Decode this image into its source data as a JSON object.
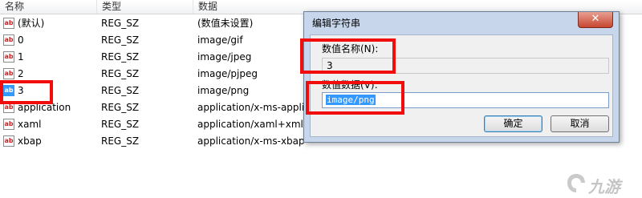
{
  "list": {
    "columns": [
      "名称",
      "类型",
      "数据"
    ],
    "rows": [
      {
        "name": "(默认)",
        "type": "REG_SZ",
        "data": "(数值未设置)"
      },
      {
        "name": "0",
        "type": "REG_SZ",
        "data": "image/gif"
      },
      {
        "name": "1",
        "type": "REG_SZ",
        "data": "image/jpeg"
      },
      {
        "name": "2",
        "type": "REG_SZ",
        "data": "image/pjpeg"
      },
      {
        "name": "3",
        "type": "REG_SZ",
        "data": "image/png"
      },
      {
        "name": "application",
        "type": "REG_SZ",
        "data": "application/x-ms-applic"
      },
      {
        "name": "xaml",
        "type": "REG_SZ",
        "data": "application/xaml+xml"
      },
      {
        "name": "xbap",
        "type": "REG_SZ",
        "data": "application/x-ms-xbap"
      }
    ],
    "icon_glyph": "ab",
    "selected_row": "3"
  },
  "dialog": {
    "title": "编辑字符串",
    "close_glyph": "✕",
    "value_name_label": "数值名称(N):",
    "value_name": "3",
    "value_data_label": "数值数据(V):",
    "value_data": "image/png",
    "ok_label": "确定",
    "cancel_label": "取消"
  },
  "watermark": {
    "text": "九游"
  },
  "colors": {
    "annotation_red": "#f20d0d",
    "selection_blue": "#3399ff",
    "dialog_frame": "#c7d6ea"
  }
}
